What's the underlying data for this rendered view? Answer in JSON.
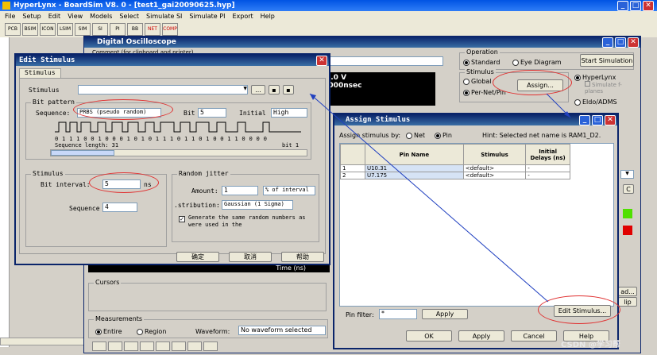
{
  "app": {
    "title": "HyperLynx - BoardSim V8. 0 - [test1_gai20090625.hyp]"
  },
  "menu": [
    "File",
    "Setup",
    "Edit",
    "View",
    "Models",
    "Select",
    "Simulate SI",
    "Simulate PI",
    "Export",
    "Help"
  ],
  "toolbar": [
    "PCB",
    "BSIM",
    "ICON",
    "LSIM",
    "SIM",
    "SI",
    "PI",
    "BB",
    "NET",
    "COMP"
  ],
  "osc": {
    "title": "Digital Oscilloscope",
    "comment_label": "Comment (for clipboard and printer)",
    "operation_label": "Operation",
    "standard": "Standard",
    "eye": "Eye Diagram",
    "start_sim": "Start Simulation",
    "stimulus_label": "Stimulus",
    "global": "Global",
    "per_net": "Per-Net/Pin",
    "assign_btn": "Assign...",
    "hyperlynx": "HyperLynx",
    "simulate_fplanes": "Simulate f-planes",
    "eldo": "Eldo/ADMS",
    "scope_v": "2.0 V",
    "scope_t": ".000nsec",
    "time_label": "Time (ns)",
    "cursors": "Cursors",
    "measurements": "Measurements",
    "entire": "Entire",
    "region": "Region",
    "waveform_label": "Waveform:",
    "waveform_value": "No waveform selected",
    "side_c": "C",
    "side_ad": "ad...",
    "side_clip": "lip"
  },
  "edit": {
    "title": "Edit Stimulus",
    "tab": "Stimulus",
    "stimulus_label": "Stimulus",
    "browse": "...",
    "bit_pattern": "Bit pattern",
    "sequence_label": "Sequence:",
    "sequence_value": "PRBS (pseudo random)",
    "bit_label": "Bit",
    "bit_value": "5",
    "initial_label": "Initial",
    "initial_value": "High",
    "bits": "0 1 1 1 0 0 1 0 0 0 1 0 1 0 1 1 1 0 1 1 0 1 0 0 1 1 0 0 0 0",
    "seq_length": "Sequence length: 31",
    "bit_end": "bit 1",
    "stim_group": "Stimulus",
    "bit_interval_label": "Bit interval:",
    "bit_interval_value": "5",
    "ns": "ns",
    "sequence2_label": "Sequence",
    "sequence2_value": "4",
    "jitter_label": "Random jitter",
    "amount_label": "Amount:",
    "amount_value": "1",
    "amount_unit": "% of interval",
    "dist_label": ".stribution:",
    "dist_value": "Gaussian (1 Sigma)",
    "gen_text": "Generate the same random numbers as were used in the",
    "ok": "确定",
    "cancel": "取消",
    "help": "帮助"
  },
  "assign": {
    "title": "Assign Stimulus",
    "by_label": "Assign stimulus by:",
    "net": "Net",
    "pin": "Pin",
    "hint": "Hint: Selected net name is RAM1_D2.",
    "cols": [
      "Pin Name",
      "Stimulus",
      "Initial Delays (ns)"
    ],
    "rows": [
      {
        "n": "1",
        "pin": "U10.31",
        "stim": "<default>",
        "delay": "-"
      },
      {
        "n": "2",
        "pin": "U7.175",
        "stim": "<default>",
        "delay": "-"
      }
    ],
    "edit_btn": "Edit Stimulus...",
    "filter_label": "Pin filter:",
    "filter_value": "*",
    "apply": "Apply",
    "ok": "OK",
    "apply2": "Apply",
    "cancel": "Cancel",
    "help": "Help"
  },
  "watermark": "CSDN @学习帮"
}
